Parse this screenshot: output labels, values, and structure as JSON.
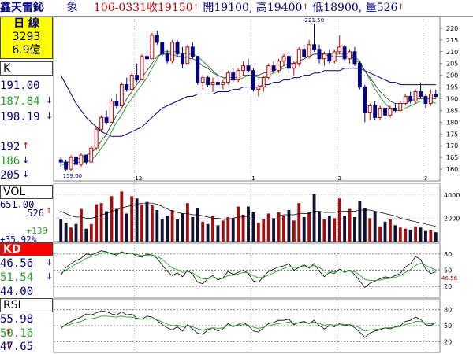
{
  "header": {
    "stock_name": "鑫天雷鈊",
    "category": "象",
    "date": "106-0331",
    "close_label": "收",
    "close": "19150",
    "open_label": "開",
    "open": "19100",
    "high_label": "高",
    "high": "19400",
    "low_label": "低",
    "low": "18900",
    "volume_label": "量",
    "volume": "526"
  },
  "info_box": {
    "period": "日 線",
    "count": "3293",
    "amount": "6.9億"
  },
  "k_panel": {
    "label": "K",
    "ma1": "191.00",
    "ma2": "187.84",
    "ma3": "198.19",
    "ind1": "192",
    "ind2": "186",
    "ind3": "205"
  },
  "vol_panel": {
    "label": "VOL",
    "v1": "651.00",
    "v2": "526",
    "v3": "+139",
    "v4": "+35.92%"
  },
  "kd_panel": {
    "label": "KD",
    "k": "46.56",
    "d": "51.54",
    "j": "44.00",
    "marker": "46.56"
  },
  "rsi_panel": {
    "label": "RSI",
    "r1": "55.98",
    "r2": "50.16",
    "r3": "47.65"
  },
  "colors": {
    "up": "#c00000",
    "down": "#000080",
    "ma_green": "#2aa02a",
    "ma_navy": "#000080",
    "ma_black": "#303030",
    "info_bg": "#ffff00",
    "kd_bg": "#ff0000"
  },
  "chart_data": {
    "type": "candlestick",
    "price_ylim": [
      155,
      225
    ],
    "price_ticks": [
      160,
      165,
      170,
      175,
      180,
      185,
      190,
      195,
      200,
      205,
      210,
      215,
      220
    ],
    "price_annotations": {
      "high": "221.50",
      "low": "159.00"
    },
    "month_labels": [
      "12",
      "1",
      "2",
      "3"
    ],
    "volume_ticks": [
      2000,
      4000
    ],
    "volume_ylim": [
      0,
      5000
    ],
    "kd_ticks": [
      20,
      50,
      80
    ],
    "rsi_ticks": [
      20,
      50,
      80
    ],
    "candles": [
      [
        164,
        165,
        161,
        163
      ],
      [
        163,
        164,
        159,
        160
      ],
      [
        160,
        166,
        159,
        165
      ],
      [
        165,
        165,
        161,
        162
      ],
      [
        162,
        167,
        161,
        166
      ],
      [
        166,
        166,
        162,
        163
      ],
      [
        163,
        170,
        163,
        169
      ],
      [
        169,
        178,
        168,
        177
      ],
      [
        177,
        183,
        176,
        182
      ],
      [
        182,
        185,
        179,
        180
      ],
      [
        180,
        190,
        180,
        189
      ],
      [
        189,
        192,
        186,
        187
      ],
      [
        187,
        197,
        187,
        196
      ],
      [
        196,
        199,
        193,
        194
      ],
      [
        194,
        201,
        194,
        200
      ],
      [
        200,
        205,
        197,
        198
      ],
      [
        198,
        209,
        198,
        208
      ],
      [
        208,
        214,
        206,
        207
      ],
      [
        207,
        218,
        207,
        217
      ],
      [
        217,
        219,
        213,
        214
      ],
      [
        214,
        214,
        208,
        209
      ],
      [
        209,
        211,
        205,
        206
      ],
      [
        206,
        215,
        205,
        214
      ],
      [
        214,
        215,
        208,
        209
      ],
      [
        209,
        212,
        203,
        205
      ],
      [
        205,
        213,
        205,
        212
      ],
      [
        212,
        214,
        207,
        208
      ],
      [
        208,
        208,
        196,
        197
      ],
      [
        197,
        200,
        194,
        199
      ],
      [
        199,
        200,
        195,
        196
      ],
      [
        196,
        199,
        193,
        197
      ],
      [
        197,
        200,
        195,
        196
      ],
      [
        196,
        198,
        194,
        197
      ],
      [
        197,
        202,
        196,
        201
      ],
      [
        201,
        203,
        197,
        198
      ],
      [
        198,
        203,
        197,
        202
      ],
      [
        202,
        206,
        200,
        204
      ],
      [
        204,
        207,
        201,
        202
      ],
      [
        202,
        203,
        193,
        194
      ],
      [
        194,
        196,
        191,
        195
      ],
      [
        195,
        200,
        193,
        199
      ],
      [
        199,
        205,
        198,
        204
      ],
      [
        204,
        206,
        201,
        202
      ],
      [
        202,
        207,
        201,
        206
      ],
      [
        206,
        209,
        204,
        208
      ],
      [
        208,
        210,
        201,
        203
      ],
      [
        203,
        206,
        200,
        205
      ],
      [
        205,
        212,
        204,
        211
      ],
      [
        211,
        213,
        207,
        208
      ],
      [
        208,
        215,
        207,
        213
      ],
      [
        213,
        222,
        210,
        211
      ],
      [
        211,
        213,
        205,
        207
      ],
      [
        207,
        210,
        204,
        209
      ],
      [
        209,
        211,
        205,
        206
      ],
      [
        206,
        211,
        205,
        210
      ],
      [
        210,
        217,
        209,
        212
      ],
      [
        212,
        213,
        206,
        207
      ],
      [
        207,
        211,
        205,
        210
      ],
      [
        210,
        212,
        204,
        205
      ],
      [
        205,
        206,
        194,
        195
      ],
      [
        195,
        196,
        180,
        184
      ],
      [
        184,
        188,
        181,
        187
      ],
      [
        187,
        189,
        181,
        182
      ],
      [
        182,
        187,
        181,
        186
      ],
      [
        186,
        187,
        182,
        183
      ],
      [
        183,
        187,
        182,
        186
      ],
      [
        186,
        188,
        184,
        185
      ],
      [
        185,
        189,
        184,
        188
      ],
      [
        188,
        192,
        187,
        191
      ],
      [
        191,
        193,
        188,
        189
      ],
      [
        189,
        194,
        188,
        193
      ],
      [
        193,
        197,
        190,
        191
      ],
      [
        191,
        192,
        186,
        188
      ],
      [
        188,
        194,
        187,
        192
      ],
      [
        192,
        194,
        190,
        191
      ]
    ],
    "volumes": [
      1900,
      1600,
      1200,
      1500,
      2800,
      1100,
      1500,
      3200,
      3300,
      2600,
      3900,
      2800,
      4300,
      2400,
      3900,
      3700,
      3200,
      3400,
      3100,
      2700,
      1900,
      2200,
      2700,
      1900,
      2400,
      3300,
      2100,
      2900,
      1700,
      1500,
      2200,
      1400,
      1800,
      2100,
      2000,
      3000,
      2300,
      3000,
      2500,
      1600,
      1900,
      2400,
      2000,
      2500,
      2200,
      2700,
      1800,
      3300,
      2100,
      2500,
      4100,
      2600,
      1900,
      2200,
      2000,
      3700,
      2200,
      2800,
      2100,
      3500,
      2900,
      2000,
      2600,
      1300,
      1700,
      1900,
      1400,
      1200,
      1100,
      1000,
      1300,
      1200,
      900,
      1000,
      800
    ],
    "kd_k": [
      40,
      55,
      62,
      68,
      72,
      80,
      78,
      82,
      86,
      84,
      80,
      78,
      84,
      80,
      82,
      76,
      74,
      80,
      78,
      72,
      60,
      48,
      40,
      45,
      38,
      50,
      42,
      28,
      25,
      35,
      40,
      32,
      36,
      48,
      42,
      46,
      50,
      44,
      30,
      28,
      38,
      48,
      52,
      56,
      58,
      62,
      50,
      55,
      60,
      54,
      62,
      48,
      38,
      46,
      44,
      52,
      46,
      50,
      42,
      30,
      18,
      26,
      30,
      34,
      38,
      36,
      40,
      44,
      56,
      62,
      75,
      70,
      52,
      44,
      47
    ],
    "kd_d": [
      45,
      50,
      56,
      62,
      66,
      72,
      75,
      78,
      82,
      83,
      82,
      80,
      82,
      81,
      81,
      79,
      77,
      78,
      78,
      76,
      70,
      62,
      54,
      51,
      46,
      47,
      45,
      39,
      34,
      34,
      36,
      35,
      35,
      40,
      41,
      43,
      46,
      45,
      40,
      36,
      37,
      41,
      45,
      50,
      53,
      57,
      55,
      55,
      57,
      56,
      59,
      55,
      49,
      48,
      47,
      49,
      48,
      49,
      47,
      41,
      33,
      31,
      31,
      32,
      34,
      35,
      37,
      40,
      46,
      51,
      59,
      63,
      59,
      54,
      51
    ],
    "rsi_fast": [
      45,
      52,
      58,
      62,
      66,
      72,
      70,
      74,
      78,
      76,
      72,
      70,
      76,
      70,
      72,
      64,
      62,
      68,
      66,
      60,
      52,
      46,
      42,
      48,
      40,
      52,
      44,
      36,
      34,
      42,
      46,
      40,
      44,
      54,
      48,
      52,
      56,
      50,
      40,
      38,
      46,
      54,
      56,
      60,
      60,
      62,
      52,
      56,
      58,
      54,
      60,
      50,
      44,
      50,
      48,
      54,
      50,
      52,
      46,
      38,
      28,
      36,
      40,
      42,
      46,
      44,
      48,
      50,
      58,
      60,
      66,
      62,
      52,
      50,
      56
    ],
    "rsi_slow": [
      48,
      50,
      53,
      56,
      58,
      62,
      63,
      65,
      68,
      68,
      67,
      66,
      68,
      66,
      66,
      63,
      62,
      63,
      63,
      61,
      57,
      53,
      50,
      51,
      48,
      50,
      48,
      44,
      42,
      44,
      46,
      45,
      46,
      50,
      49,
      50,
      52,
      51,
      47,
      45,
      47,
      50,
      52,
      54,
      55,
      57,
      54,
      55,
      56,
      55,
      57,
      54,
      51,
      52,
      51,
      53,
      52,
      52,
      50,
      46,
      40,
      42,
      43,
      44,
      46,
      46,
      47,
      48,
      52,
      54,
      58,
      58,
      55,
      53,
      55
    ],
    "ma_short_green": [
      162,
      162,
      162,
      163,
      163,
      163,
      164,
      166,
      169,
      172,
      176,
      180,
      183,
      187,
      190,
      193,
      196,
      199,
      203,
      207,
      210,
      210,
      210,
      210,
      209,
      209,
      209,
      208,
      206,
      204,
      202,
      200,
      199,
      198,
      198,
      198,
      199,
      200,
      200,
      199,
      199,
      200,
      201,
      202,
      203,
      204,
      205,
      206,
      207,
      208,
      209,
      209,
      209,
      209,
      209,
      209,
      209,
      209,
      208,
      206,
      202,
      198,
      194,
      191,
      188,
      186,
      185,
      185,
      186,
      187,
      188,
      189,
      189,
      189,
      188
    ],
    "ma_mid_navy": [
      200,
      196,
      192,
      188,
      185,
      182,
      180,
      178,
      176,
      175,
      174,
      174,
      174,
      175,
      176,
      177,
      178,
      180,
      182,
      184,
      186,
      187,
      188,
      189,
      190,
      191,
      191,
      192,
      192,
      192,
      192,
      193,
      193,
      193,
      194,
      194,
      195,
      195,
      195,
      195,
      196,
      196,
      197,
      197,
      198,
      198,
      199,
      199,
      200,
      200,
      201,
      201,
      202,
      202,
      202,
      202,
      203,
      203,
      203,
      203,
      202,
      201,
      200,
      199,
      198,
      197,
      197,
      196,
      196,
      196,
      196,
      196,
      196,
      196,
      196
    ],
    "ma_long_black": [
      163,
      163,
      163,
      164,
      165,
      166,
      167,
      169,
      172,
      175,
      179,
      183,
      186,
      190,
      193,
      196,
      199,
      202,
      205,
      208,
      209,
      209,
      209,
      208,
      208,
      207,
      207,
      206,
      204,
      203,
      201,
      200,
      199,
      199,
      199,
      199,
      200,
      200,
      200,
      200,
      201,
      201,
      202,
      203,
      204,
      205,
      205,
      206,
      207,
      208,
      209,
      209,
      209,
      208,
      208,
      208,
      208,
      208,
      207,
      205,
      202,
      199,
      196,
      193,
      191,
      189,
      188,
      188,
      188,
      189,
      190,
      190,
      190,
      190,
      190
    ],
    "vol_ma": [
      2600,
      2400,
      2200,
      2100,
      2100,
      2000,
      2000,
      2100,
      2300,
      2400,
      2600,
      2700,
      2900,
      3000,
      3100,
      3200,
      3300,
      3300,
      3300,
      3200,
      3000,
      2800,
      2600,
      2500,
      2400,
      2400,
      2300,
      2300,
      2200,
      2100,
      2000,
      2000,
      1900,
      1900,
      2000,
      2100,
      2100,
      2200,
      2200,
      2200,
      2200,
      2200,
      2200,
      2200,
      2300,
      2300,
      2300,
      2400,
      2400,
      2400,
      2600,
      2600,
      2500,
      2500,
      2500,
      2600,
      2600,
      2600,
      2600,
      2700,
      2700,
      2700,
      2600,
      2500,
      2400,
      2300,
      2200,
      2000,
      1900,
      1800,
      1700,
      1600,
      1500,
      1400,
      1300
    ]
  }
}
